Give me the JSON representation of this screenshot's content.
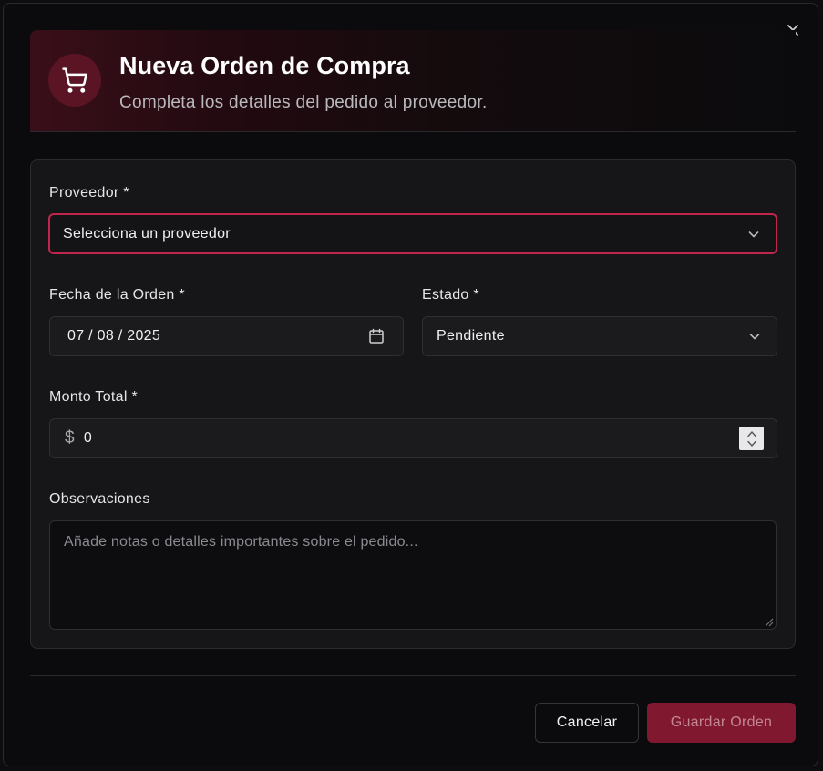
{
  "dialog": {
    "title": "Nueva Orden de Compra",
    "subtitle": "Completa los detalles del pedido al proveedor.",
    "close_icon": "close-icon",
    "header_icon": "shopping-cart-icon"
  },
  "form": {
    "proveedor": {
      "label": "Proveedor *",
      "value": "Selecciona un proveedor"
    },
    "fecha": {
      "label": "Fecha de la Orden *",
      "value": "07 / 08 / 2025"
    },
    "estado": {
      "label": "Estado *",
      "value": "Pendiente"
    },
    "monto": {
      "label": "Monto Total *",
      "currency": "$",
      "value": "0"
    },
    "observaciones": {
      "label": "Observaciones",
      "placeholder": "Añade notas o detalles importantes sobre el pedido..."
    }
  },
  "footer": {
    "cancel_label": "Cancelar",
    "save_label": "Guardar Orden"
  },
  "colors": {
    "accent": "#801830",
    "focus_border": "#c0264d",
    "background": "#0b0b0d"
  }
}
